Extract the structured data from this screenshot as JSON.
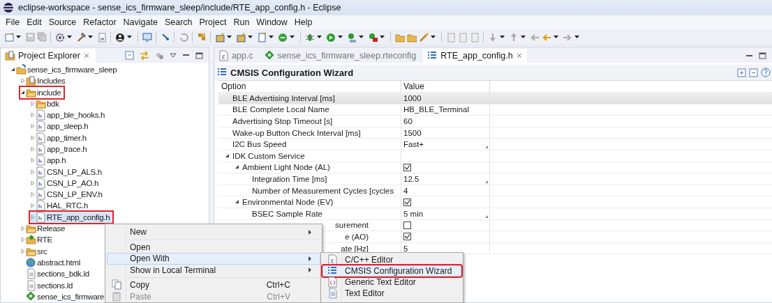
{
  "window": {
    "title": "eclipse-workspace - sense_ics_firmware_sleep/include/RTE_app_config.h - Eclipse"
  },
  "menu_bar": [
    "File",
    "Edit",
    "Source",
    "Refactor",
    "Navigate",
    "Search",
    "Project",
    "Run",
    "Window",
    "Help"
  ],
  "project_explorer": {
    "title": "Project Explorer",
    "tree": [
      {
        "label": "sense_ics_firmware_sleep",
        "kind": "project",
        "expanded": true,
        "selected": false,
        "highlighted": false,
        "children": [
          {
            "label": "Includes",
            "kind": "includes",
            "expanded": false,
            "selected": false,
            "highlighted": false
          },
          {
            "label": "include",
            "kind": "folder",
            "expanded": true,
            "selected": false,
            "highlighted": true,
            "children": [
              {
                "label": "bdk",
                "kind": "folder",
                "expanded": false,
                "selected": false,
                "highlighted": false
              },
              {
                "label": "app_ble_hooks.h",
                "kind": "header",
                "expanded": false,
                "selected": false,
                "highlighted": false
              },
              {
                "label": "app_sleep.h",
                "kind": "header",
                "expanded": false,
                "selected": false,
                "highlighted": false
              },
              {
                "label": "app_timer.h",
                "kind": "header",
                "expanded": false,
                "selected": false,
                "highlighted": false
              },
              {
                "label": "app_trace.h",
                "kind": "header",
                "expanded": false,
                "selected": false,
                "highlighted": false
              },
              {
                "label": "app.h",
                "kind": "header",
                "expanded": false,
                "selected": false,
                "highlighted": false
              },
              {
                "label": "CSN_LP_ALS.h",
                "kind": "header",
                "expanded": false,
                "selected": false,
                "highlighted": false
              },
              {
                "label": "CSN_LP_AO.h",
                "kind": "header",
                "expanded": false,
                "selected": false,
                "highlighted": false
              },
              {
                "label": "CSN_LP_ENV.h",
                "kind": "header",
                "expanded": false,
                "selected": false,
                "highlighted": false
              },
              {
                "label": "HAL_RTC.h",
                "kind": "header",
                "expanded": false,
                "selected": false,
                "highlighted": false
              },
              {
                "label": "RTE_app_config.h",
                "kind": "header",
                "expanded": false,
                "selected": true,
                "highlighted": true
              }
            ]
          },
          {
            "label": "Release",
            "kind": "folder",
            "expanded": false,
            "selected": false,
            "highlighted": false
          },
          {
            "label": "RTE",
            "kind": "rte",
            "expanded": false,
            "selected": false,
            "highlighted": false
          },
          {
            "label": "src",
            "kind": "folder",
            "expanded": false,
            "selected": false,
            "highlighted": false
          },
          {
            "label": "abstract.html",
            "kind": "html",
            "selected": false,
            "highlighted": false
          },
          {
            "label": "sections_bdk.ld",
            "kind": "ld",
            "selected": false,
            "highlighted": false
          },
          {
            "label": "sections.ld",
            "kind": "ld",
            "selected": false,
            "highlighted": false
          },
          {
            "label": "sense_ics_firmware",
            "kind": "rteconfig",
            "selected": false,
            "highlighted": false
          }
        ]
      }
    ]
  },
  "editor": {
    "tabs": [
      {
        "label": "app.c",
        "kind": "c",
        "selected": false
      },
      {
        "label": "sense_ics_firmware_sleep.rteconfig",
        "kind": "rteconfig",
        "selected": false
      },
      {
        "label": "RTE_app_config.h",
        "kind": "wizard",
        "selected": true
      }
    ],
    "title": "CMSIS Configuration Wizard",
    "table": {
      "columns": [
        "Option",
        "Value"
      ],
      "rows": [
        {
          "option": "BLE Advertising Interval [ms]",
          "kind": "text",
          "value": "1000",
          "selected": true
        },
        {
          "option": "BLE Complete Local Name",
          "kind": "text",
          "value": "HB_BLE_Terminal",
          "selected": false
        },
        {
          "option": "Advertising Stop Timeout [s]",
          "kind": "text",
          "value": "60",
          "selected": false
        },
        {
          "option": "Wake-up Button Check Interval [ms]",
          "kind": "text",
          "value": "1500",
          "selected": false
        },
        {
          "option": "I2C Bus Speed",
          "kind": "dropdown",
          "value": "Fast+",
          "selected": false
        },
        {
          "option": "IDK Custom Service",
          "kind": "group",
          "expanded": true,
          "selected": false,
          "children": [
            {
              "option": "Ambient Light Node (AL)",
              "kind": "checkbox",
              "checked": true,
              "expanded": true,
              "selected": false,
              "children": [
                {
                  "option": "Integration Time [ms]",
                  "kind": "dropdown",
                  "value": "12.5",
                  "selected": false
                },
                {
                  "option": "Number of Measurement Cycles [cycles",
                  "kind": "text",
                  "value": "4",
                  "selected": false
                }
              ]
            },
            {
              "option": "Environmental Node (EV)",
              "kind": "checkbox",
              "checked": true,
              "expanded": true,
              "selected": false,
              "children": [
                {
                  "option": "BSEC Sample Rate",
                  "kind": "dropdown",
                  "value": "5 min",
                  "selected": false
                },
                {
                  "option": "surement",
                  "kind": "checkbox",
                  "checked": false,
                  "partial": true,
                  "selected": false
                }
              ]
            },
            {
              "option": "e (AO)",
              "kind": "checkbox",
              "checked": true,
              "partial": true,
              "selected": false,
              "children": [
                {
                  "option": "ate [Hz]",
                  "kind": "text",
                  "value": "5",
                  "partial": true,
                  "selected": false
                }
              ]
            }
          ]
        }
      ]
    }
  },
  "context_menu": {
    "items": [
      {
        "label": "New",
        "kind": "submenu",
        "hovered": false
      },
      {
        "kind": "separator"
      },
      {
        "label": "Open",
        "kind": "item",
        "hovered": false
      },
      {
        "label": "Open With",
        "kind": "submenu",
        "hovered": true
      },
      {
        "label": "Show in Local Terminal",
        "kind": "submenu",
        "hovered": false
      },
      {
        "kind": "separator"
      },
      {
        "label": "Copy",
        "kind": "item",
        "shortcut": "Ctrl+C",
        "hovered": false
      },
      {
        "label": "Paste",
        "kind": "item",
        "shortcut": "Ctrl+V",
        "disabled": true,
        "hovered": false
      }
    ]
  },
  "submenu": {
    "items": [
      {
        "label": "C/C++ Editor",
        "hovered": false,
        "highlighted": false
      },
      {
        "label": "CMSIS Configuration Wizard",
        "hovered": true,
        "highlighted": true
      },
      {
        "label": "Generic Text Editor",
        "hovered": false,
        "highlighted": false
      },
      {
        "label": "Text Editor",
        "hovered": false,
        "highlighted": false
      }
    ]
  }
}
